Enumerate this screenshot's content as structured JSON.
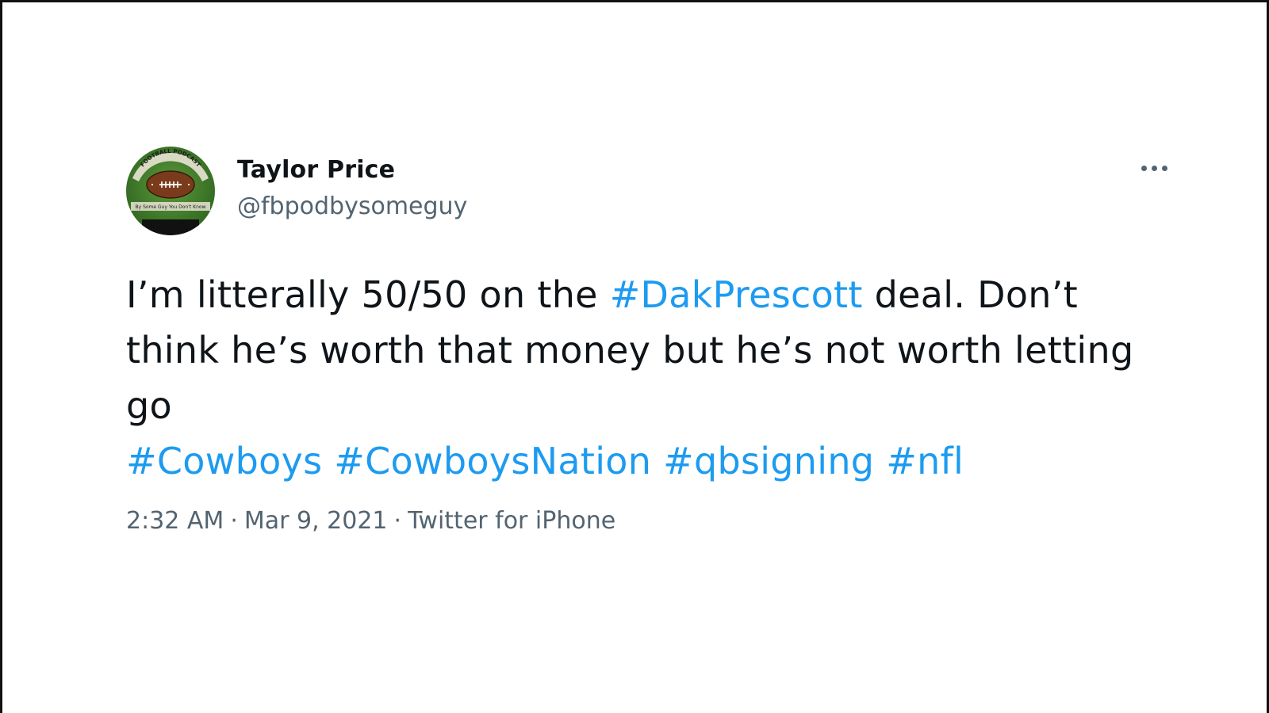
{
  "author": {
    "display_name": "Taylor Price",
    "handle": "@fbpodbysomeguy",
    "avatar": {
      "icon": "football-podcast-logo-avatar",
      "text_top": "FOOTBALL PODCAST",
      "text_bottom": "By Some Guy You Don't Know"
    }
  },
  "more_icon": "ellipsis-icon",
  "tweet": {
    "line1_pre": "I’m litterally 50/50 on the ",
    "line1_tag": "#DakPrescott",
    "line1_post": " deal. Don’t",
    "line2": "think he’s worth that money but he’s not worth letting",
    "line3": "go",
    "hashtags": [
      "#Cowboys",
      "#CowboysNation",
      "#qbsigning",
      "#nfl"
    ]
  },
  "meta": {
    "time": "2:32 AM",
    "date": "Mar 9, 2021",
    "source": "Twitter for iPhone",
    "separator": "·"
  },
  "colors": {
    "link": "#1d9bf0",
    "text": "#0f1419",
    "secondary": "#536471",
    "avatar_grass": "#3f7a2a",
    "football": "#7a3b1c"
  }
}
